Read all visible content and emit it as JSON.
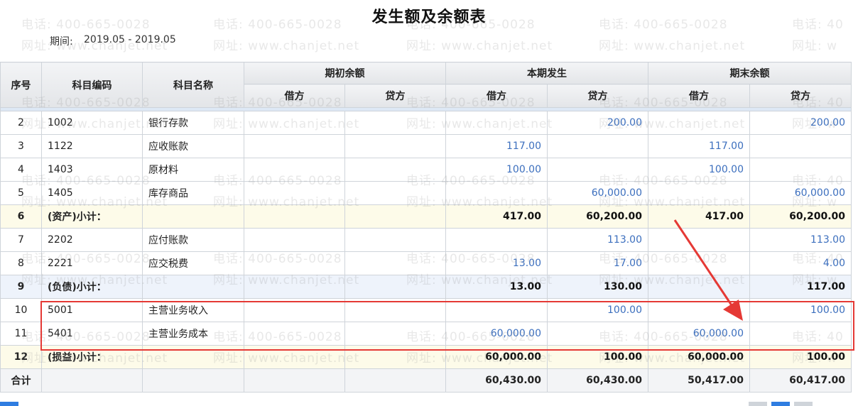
{
  "report": {
    "title": "发生额及余额表",
    "period_label": "期间:",
    "period_value": "2019.05 - 2019.05"
  },
  "watermark": {
    "phone": "电话: 400-665-0028",
    "site": "网址: www.chanjet.net",
    "phone_fragment": "电话: 40",
    "site_fragment": "网址: w"
  },
  "headers": {
    "seq": "序号",
    "code": "科目编码",
    "name": "科目名称",
    "opening": "期初余额",
    "current": "本期发生",
    "closing": "期末余额",
    "debit": "借方",
    "credit": "贷方"
  },
  "rows": [
    {
      "seq": "2",
      "code": "1002",
      "name": "银行存款",
      "od": "",
      "oc": "",
      "cd": "",
      "cc": "200.00",
      "ed": "",
      "ec": "200.00"
    },
    {
      "seq": "3",
      "code": "1122",
      "name": "应收账款",
      "od": "",
      "oc": "",
      "cd": "117.00",
      "cc": "",
      "ed": "117.00",
      "ec": ""
    },
    {
      "seq": "4",
      "code": "1403",
      "name": "原材料",
      "od": "",
      "oc": "",
      "cd": "100.00",
      "cc": "",
      "ed": "100.00",
      "ec": ""
    },
    {
      "seq": "5",
      "code": "1405",
      "name": "库存商品",
      "od": "",
      "oc": "",
      "cd": "",
      "cc": "60,000.00",
      "ed": "",
      "ec": "60,000.00"
    },
    {
      "seq": "6",
      "label": "(资产)小计：",
      "od": "",
      "oc": "",
      "cd": "417.00",
      "cc": "60,200.00",
      "ed": "417.00",
      "ec": "60,200.00"
    },
    {
      "seq": "7",
      "code": "2202",
      "name": "应付账款",
      "od": "",
      "oc": "",
      "cd": "",
      "cc": "113.00",
      "ed": "",
      "ec": "113.00"
    },
    {
      "seq": "8",
      "code": "2221",
      "name": "应交税费",
      "od": "",
      "oc": "",
      "cd": "13.00",
      "cc": "17.00",
      "ed": "",
      "ec": "4.00"
    },
    {
      "seq": "9",
      "label": "(负债)小计：",
      "od": "",
      "oc": "",
      "cd": "13.00",
      "cc": "130.00",
      "ed": "",
      "ec": "117.00"
    },
    {
      "seq": "10",
      "code": "5001",
      "name": "主营业务收入",
      "od": "",
      "oc": "",
      "cd": "",
      "cc": "100.00",
      "ed": "",
      "ec": "100.00"
    },
    {
      "seq": "11",
      "code": "5401",
      "name": "主营业务成本",
      "od": "",
      "oc": "",
      "cd": "60,000.00",
      "cc": "",
      "ed": "60,000.00",
      "ec": ""
    },
    {
      "seq": "12",
      "label": "(损益)小计：",
      "od": "",
      "oc": "",
      "cd": "60,000.00",
      "cc": "100.00",
      "ed": "60,000.00",
      "ec": "100.00"
    }
  ],
  "total": {
    "label": "合计",
    "cd": "60,430.00",
    "cc": "60,430.00",
    "ed": "50,417.00",
    "ec": "60,417.00"
  },
  "colors": {
    "annotation": "#e53935",
    "amount_blue": "#3c6fbe",
    "subtotal_asset_bg": "#fdfbe9",
    "subtotal_liability_bg": "#eef3fb",
    "button_blue": "#2f7de1"
  }
}
